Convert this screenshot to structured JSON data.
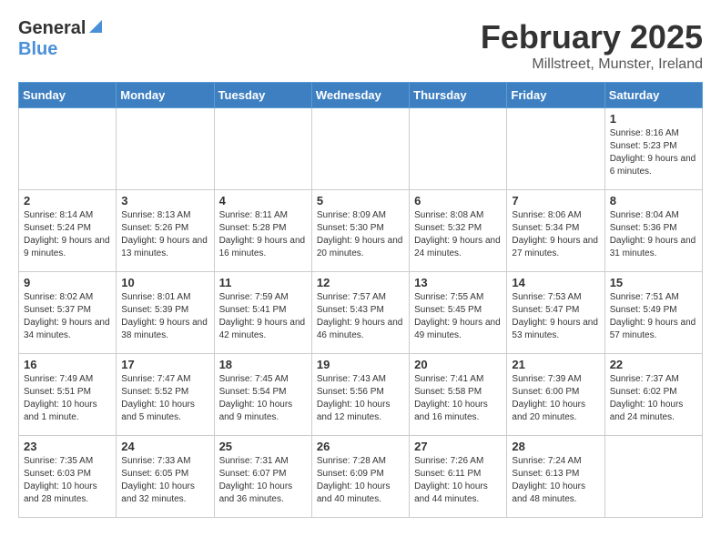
{
  "header": {
    "logo_general": "General",
    "logo_blue": "Blue",
    "month": "February 2025",
    "location": "Millstreet, Munster, Ireland"
  },
  "weekdays": [
    "Sunday",
    "Monday",
    "Tuesday",
    "Wednesday",
    "Thursday",
    "Friday",
    "Saturday"
  ],
  "weeks": [
    [
      {
        "day": "",
        "info": ""
      },
      {
        "day": "",
        "info": ""
      },
      {
        "day": "",
        "info": ""
      },
      {
        "day": "",
        "info": ""
      },
      {
        "day": "",
        "info": ""
      },
      {
        "day": "",
        "info": ""
      },
      {
        "day": "1",
        "info": "Sunrise: 8:16 AM\nSunset: 5:23 PM\nDaylight: 9 hours and 6 minutes."
      }
    ],
    [
      {
        "day": "2",
        "info": "Sunrise: 8:14 AM\nSunset: 5:24 PM\nDaylight: 9 hours and 9 minutes."
      },
      {
        "day": "3",
        "info": "Sunrise: 8:13 AM\nSunset: 5:26 PM\nDaylight: 9 hours and 13 minutes."
      },
      {
        "day": "4",
        "info": "Sunrise: 8:11 AM\nSunset: 5:28 PM\nDaylight: 9 hours and 16 minutes."
      },
      {
        "day": "5",
        "info": "Sunrise: 8:09 AM\nSunset: 5:30 PM\nDaylight: 9 hours and 20 minutes."
      },
      {
        "day": "6",
        "info": "Sunrise: 8:08 AM\nSunset: 5:32 PM\nDaylight: 9 hours and 24 minutes."
      },
      {
        "day": "7",
        "info": "Sunrise: 8:06 AM\nSunset: 5:34 PM\nDaylight: 9 hours and 27 minutes."
      },
      {
        "day": "8",
        "info": "Sunrise: 8:04 AM\nSunset: 5:36 PM\nDaylight: 9 hours and 31 minutes."
      }
    ],
    [
      {
        "day": "9",
        "info": "Sunrise: 8:02 AM\nSunset: 5:37 PM\nDaylight: 9 hours and 34 minutes."
      },
      {
        "day": "10",
        "info": "Sunrise: 8:01 AM\nSunset: 5:39 PM\nDaylight: 9 hours and 38 minutes."
      },
      {
        "day": "11",
        "info": "Sunrise: 7:59 AM\nSunset: 5:41 PM\nDaylight: 9 hours and 42 minutes."
      },
      {
        "day": "12",
        "info": "Sunrise: 7:57 AM\nSunset: 5:43 PM\nDaylight: 9 hours and 46 minutes."
      },
      {
        "day": "13",
        "info": "Sunrise: 7:55 AM\nSunset: 5:45 PM\nDaylight: 9 hours and 49 minutes."
      },
      {
        "day": "14",
        "info": "Sunrise: 7:53 AM\nSunset: 5:47 PM\nDaylight: 9 hours and 53 minutes."
      },
      {
        "day": "15",
        "info": "Sunrise: 7:51 AM\nSunset: 5:49 PM\nDaylight: 9 hours and 57 minutes."
      }
    ],
    [
      {
        "day": "16",
        "info": "Sunrise: 7:49 AM\nSunset: 5:51 PM\nDaylight: 10 hours and 1 minute."
      },
      {
        "day": "17",
        "info": "Sunrise: 7:47 AM\nSunset: 5:52 PM\nDaylight: 10 hours and 5 minutes."
      },
      {
        "day": "18",
        "info": "Sunrise: 7:45 AM\nSunset: 5:54 PM\nDaylight: 10 hours and 9 minutes."
      },
      {
        "day": "19",
        "info": "Sunrise: 7:43 AM\nSunset: 5:56 PM\nDaylight: 10 hours and 12 minutes."
      },
      {
        "day": "20",
        "info": "Sunrise: 7:41 AM\nSunset: 5:58 PM\nDaylight: 10 hours and 16 minutes."
      },
      {
        "day": "21",
        "info": "Sunrise: 7:39 AM\nSunset: 6:00 PM\nDaylight: 10 hours and 20 minutes."
      },
      {
        "day": "22",
        "info": "Sunrise: 7:37 AM\nSunset: 6:02 PM\nDaylight: 10 hours and 24 minutes."
      }
    ],
    [
      {
        "day": "23",
        "info": "Sunrise: 7:35 AM\nSunset: 6:03 PM\nDaylight: 10 hours and 28 minutes."
      },
      {
        "day": "24",
        "info": "Sunrise: 7:33 AM\nSunset: 6:05 PM\nDaylight: 10 hours and 32 minutes."
      },
      {
        "day": "25",
        "info": "Sunrise: 7:31 AM\nSunset: 6:07 PM\nDaylight: 10 hours and 36 minutes."
      },
      {
        "day": "26",
        "info": "Sunrise: 7:28 AM\nSunset: 6:09 PM\nDaylight: 10 hours and 40 minutes."
      },
      {
        "day": "27",
        "info": "Sunrise: 7:26 AM\nSunset: 6:11 PM\nDaylight: 10 hours and 44 minutes."
      },
      {
        "day": "28",
        "info": "Sunrise: 7:24 AM\nSunset: 6:13 PM\nDaylight: 10 hours and 48 minutes."
      },
      {
        "day": "",
        "info": ""
      }
    ]
  ]
}
